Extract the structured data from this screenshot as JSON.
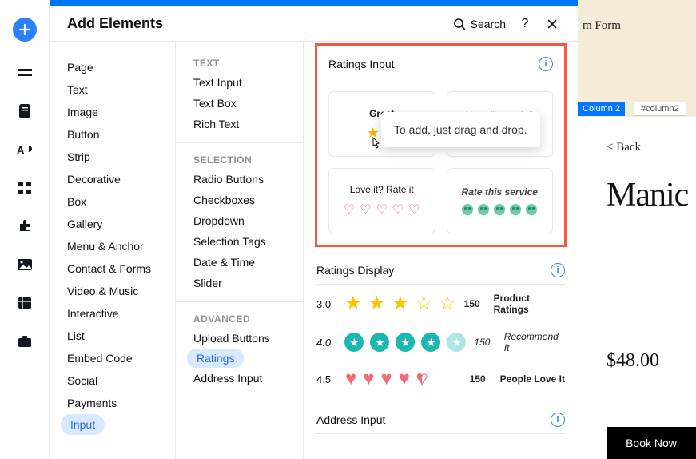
{
  "header": {
    "title": "Add Elements",
    "search_label": "Search"
  },
  "col1": {
    "items": [
      "Page",
      "Text",
      "Image",
      "Button",
      "Strip",
      "Decorative",
      "Box",
      "Gallery",
      "Menu & Anchor",
      "Contact & Forms",
      "Video & Music",
      "Interactive",
      "List",
      "Embed Code",
      "Social",
      "Payments",
      "Input"
    ],
    "selected_index": 16
  },
  "col2": {
    "groups": [
      {
        "label": "TEXT",
        "items": [
          "Text Input",
          "Text Box",
          "Rich Text"
        ]
      },
      {
        "label": "SELECTION",
        "items": [
          "Radio Buttons",
          "Checkboxes",
          "Dropdown",
          "Selection Tags",
          "Date & Time",
          "Slider"
        ]
      },
      {
        "label": "ADVANCED",
        "items": [
          "Upload Buttons",
          "Ratings",
          "Address Input"
        ]
      }
    ],
    "selected": "Ratings"
  },
  "ratings_input": {
    "title": "Ratings Input",
    "cards": [
      {
        "label": "Great"
      },
      {
        "label": "How did we do?"
      },
      {
        "label": "Love it? Rate it"
      },
      {
        "label": "Rate this service"
      }
    ],
    "tooltip": "To add, just drag and drop."
  },
  "ratings_display": {
    "title": "Ratings Display",
    "rows": [
      {
        "value": "3.0",
        "count": "150",
        "label": "Product Ratings"
      },
      {
        "value": "4.0",
        "count": "150",
        "label": "Recommend It"
      },
      {
        "value": "4.5",
        "count": "150",
        "label": "People Love It"
      }
    ]
  },
  "address_input": {
    "title": "Address Input"
  },
  "canvas": {
    "form_label": "m Form",
    "column_tag": "Column 2",
    "column_id": "#column2",
    "back": "<  Back",
    "title": "Manic",
    "price": "$48.00",
    "cta": "Book Now"
  }
}
